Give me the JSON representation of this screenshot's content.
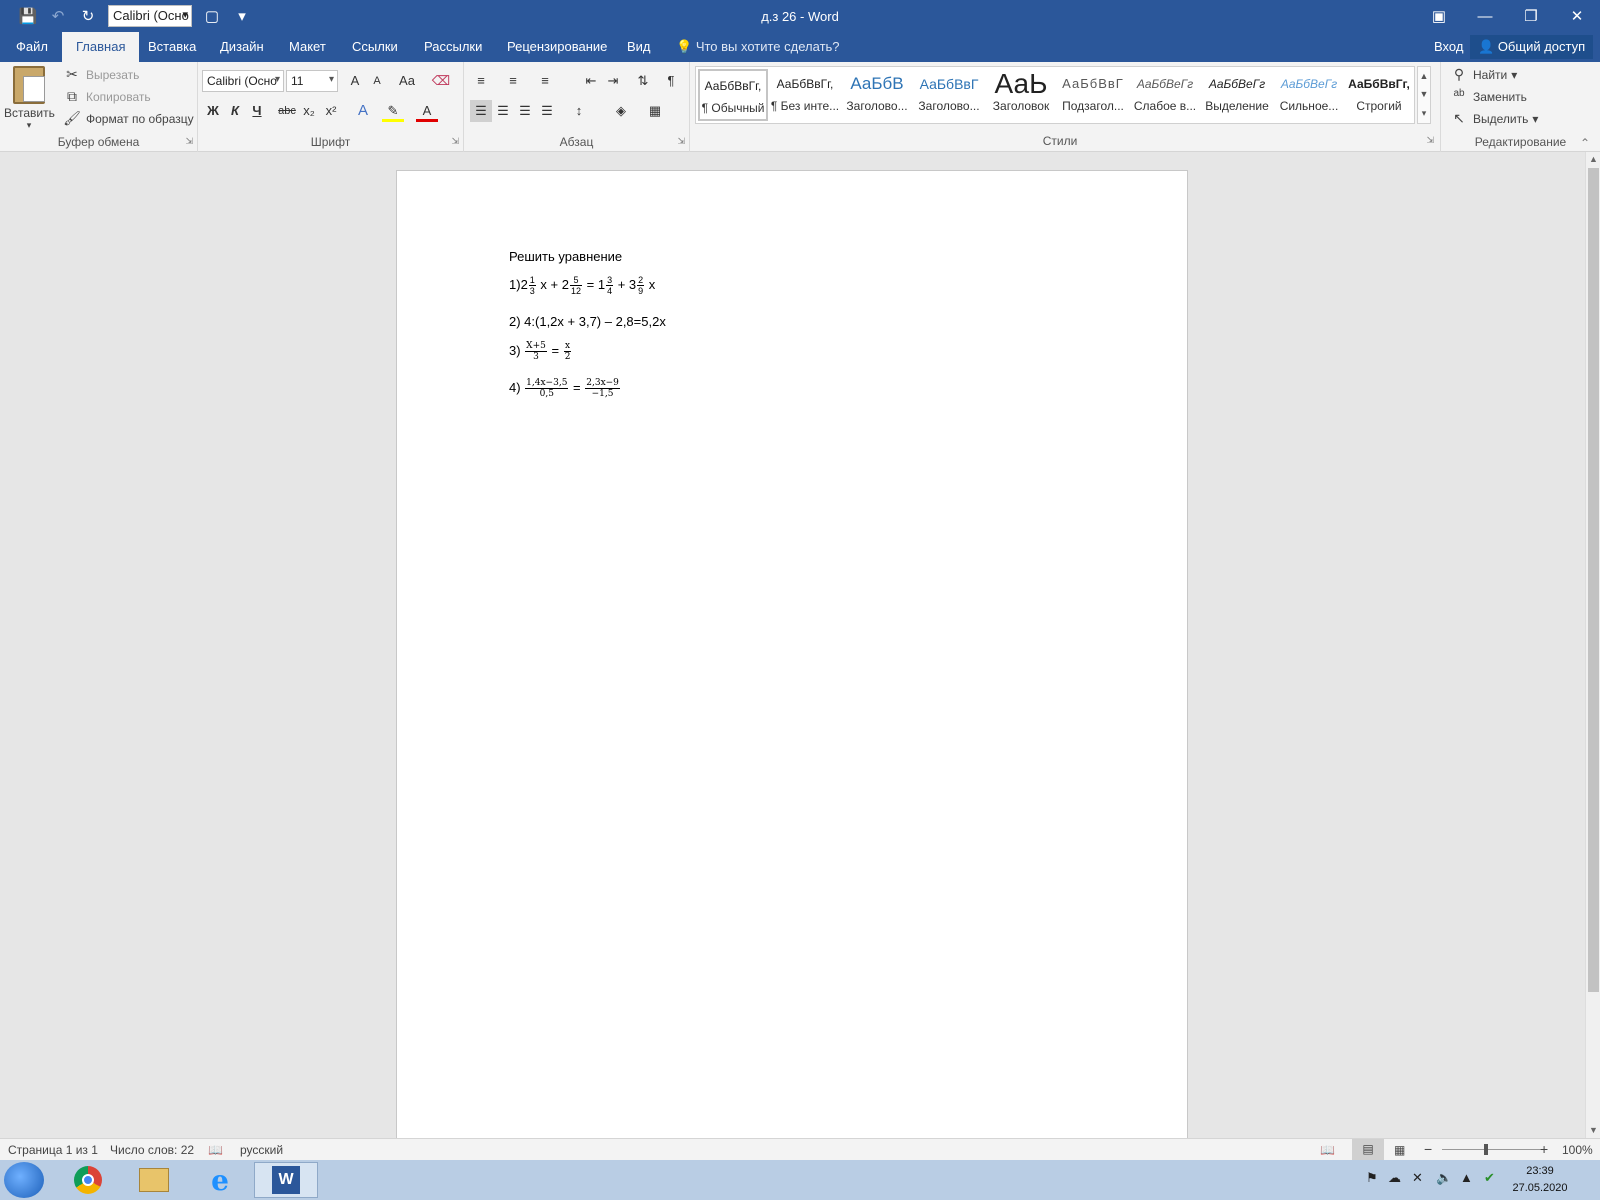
{
  "window": {
    "title": "д.з 26 - Word"
  },
  "qat": {
    "font_box": "Calibri (Осно"
  },
  "tabs": [
    {
      "label": "Файл"
    },
    {
      "label": "Главная"
    },
    {
      "label": "Вставка"
    },
    {
      "label": "Дизайн"
    },
    {
      "label": "Макет"
    },
    {
      "label": "Ссылки"
    },
    {
      "label": "Рассылки"
    },
    {
      "label": "Рецензирование"
    },
    {
      "label": "Вид"
    }
  ],
  "tell_me": "Что вы хотите сделать?",
  "signin": "Вход",
  "share": "Общий доступ",
  "clipboard": {
    "paste": "Вставить",
    "cut": "Вырезать",
    "copy": "Копировать",
    "format_painter": "Формат по образцу",
    "label": "Буфер обмена"
  },
  "font": {
    "name": "Calibri (Осно",
    "size": "11",
    "label": "Шрифт",
    "bold": "Ж",
    "italic": "К",
    "underline": "Ч",
    "strike": "abc",
    "sub": "x₂",
    "sup": "x²",
    "grow": "A",
    "shrink": "A",
    "case": "Aa"
  },
  "paragraph": {
    "label": "Абзац"
  },
  "styles": {
    "label": "Стили",
    "items": [
      {
        "preview": "АаБбВвГг,",
        "name": "¶ Обычный"
      },
      {
        "preview": "АаБбВвГг,",
        "name": "¶ Без инте..."
      },
      {
        "preview": "АаБбВ",
        "name": "Заголово..."
      },
      {
        "preview": "АаБбВвГ",
        "name": "Заголово..."
      },
      {
        "preview": "АаЬ",
        "name": "Заголовок"
      },
      {
        "preview": "АаБбВвГ",
        "name": "Подзагол..."
      },
      {
        "preview": "АаБбВеГг",
        "name": "Слабое в..."
      },
      {
        "preview": "АаБбВеГг",
        "name": "Выделение"
      },
      {
        "preview": "АаБбВеГг",
        "name": "Сильное..."
      },
      {
        "preview": "АаБбВвГг,",
        "name": "Строгий"
      }
    ]
  },
  "editing": {
    "find": "Найти",
    "replace": "Заменить",
    "select": "Выделить",
    "label": "Редактирование"
  },
  "document": {
    "heading": "Решить уравнение",
    "eq1": {
      "prefix": "1)",
      "a_whole": "2",
      "a_num": "1",
      "a_den": "3",
      "t1": " x + ",
      "b_whole": "2",
      "b_num": "5",
      "b_den": "12",
      "t2": " = ",
      "c_whole": "1",
      "c_num": "3",
      "c_den": "4",
      "t3": " + ",
      "d_whole": "3",
      "d_num": "2",
      "d_den": "9",
      "t4": " x"
    },
    "eq2": "2) 4:(1,2x + 3,7) – 2,8=5,2x",
    "eq3": {
      "prefix": "3) ",
      "l_num": "X+5",
      "l_den": "3",
      "eq": " = ",
      "r_num": "x",
      "r_den": "2"
    },
    "eq4": {
      "prefix": "4) ",
      "l_num": "1,4x−3,5",
      "l_den": "0,5",
      "eq": " = ",
      "r_num": "2,3x−9",
      "r_den": "−1,5"
    }
  },
  "status": {
    "page": "Страница 1 из 1",
    "words": "Число слов: 22",
    "lang": "русский",
    "zoom": "100%"
  },
  "taskbar": {
    "time": "23:39",
    "date": "27.05.2020"
  }
}
